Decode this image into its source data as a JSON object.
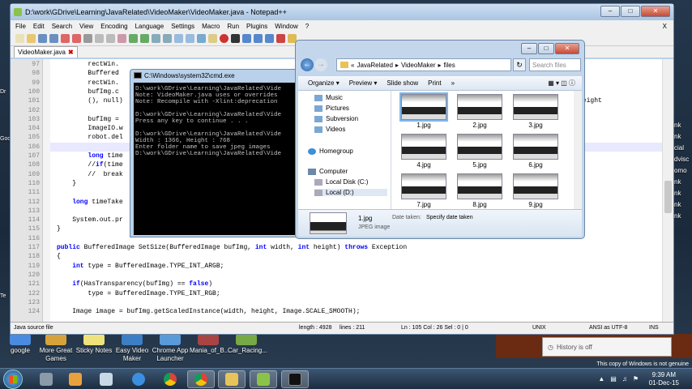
{
  "notepad": {
    "title": "D:\\work\\GDrive\\Learning\\JavaRelated\\VideoMaker\\VideoMaker.java - Notepad++",
    "menu": [
      "File",
      "Edit",
      "Search",
      "View",
      "Encoding",
      "Language",
      "Settings",
      "Macro",
      "Run",
      "Plugins",
      "Window",
      "?"
    ],
    "close_x": "X",
    "tab": "VideoMaker.java",
    "lines": [
      {
        "n": "97",
        "code": "        rectWin."
      },
      {
        "n": "98",
        "code": "        Buffered"
      },
      {
        "n": "99",
        "code": "        rectWin."
      },
      {
        "n": "100",
        "code": "        bufImg.c"
      },
      {
        "n": "101",
        "code": "        (), null)"
      },
      {
        "n": "102",
        "code": ""
      },
      {
        "n": "103",
        "code": "        bufImg ="
      },
      {
        "n": "104",
        "code": "        ImageIO.w"
      },
      {
        "n": "105",
        "code": "        robot.del"
      },
      {
        "n": "106",
        "code": ""
      },
      {
        "n": "107",
        "code": "        long time"
      },
      {
        "n": "108",
        "code": "        //if(time"
      },
      {
        "n": "109",
        "code": "        //  break"
      },
      {
        "n": "110",
        "code": "    }"
      },
      {
        "n": "111",
        "code": ""
      },
      {
        "n": "112",
        "code": "    long timeTake"
      },
      {
        "n": "113",
        "code": ""
      },
      {
        "n": "114",
        "code": "    System.out.pr"
      },
      {
        "n": "115",
        "code": "}"
      },
      {
        "n": "116",
        "code": ""
      },
      {
        "n": "117",
        "code": "public BufferedImage SetSize(BufferedImage bufImg, int width, int height) throws Exception"
      },
      {
        "n": "118",
        "code": "{"
      },
      {
        "n": "119",
        "code": "    int type = BufferedImage.TYPE_INT_ARGB;"
      },
      {
        "n": "120",
        "code": ""
      },
      {
        "n": "121",
        "code": "    if(HasTransparency(bufImg) == false)"
      },
      {
        "n": "122",
        "code": "        type = BufferedImage.TYPE_INT_RGB;"
      },
      {
        "n": "123",
        "code": ""
      },
      {
        "n": "124",
        "code": "    Image image = bufImg.getScaledInstance(width, height, Image.SCALE_SMOOTH);"
      }
    ],
    "right_fragment": "cursor.getHeight",
    "status": {
      "type": "Java source file",
      "length": "length : 4928",
      "lines": "lines : 211",
      "pos": "Ln : 105    Col : 26    Sel : 0 | 0",
      "eol": "UNIX",
      "enc": "ANSI as UTF-8",
      "ins": "INS"
    }
  },
  "cmd": {
    "title": "C:\\Windows\\system32\\cmd.exe",
    "output": "D:\\work\\GDrive\\Learning\\JavaRelated\\Vide\nNote: VideoMaker.java uses or overrides\nNote: Recompile with -Xlint:deprecation\n\nD:\\work\\GDrive\\Learning\\JavaRelated\\Vide\nPress any key to continue . . .\n\nD:\\work\\GDrive\\Learning\\JavaRelated\\Vide\nWidth : 1366, Height : 768\nEnter folder name to save jpeg images\nD:\\work\\GDrive\\Learning\\JavaRelated\\Vide"
  },
  "explorer": {
    "breadcrumb": [
      "«",
      "JavaRelated",
      "VideoMaker",
      "files"
    ],
    "search_placeholder": "Search files",
    "commands": [
      "Organize",
      "Preview",
      "Slide show",
      "Print",
      "»"
    ],
    "nav": [
      "Music",
      "Pictures",
      "Subversion",
      "Videos",
      "Homegroup",
      "Computer",
      "Local Disk (C:)",
      "Local (D:)"
    ],
    "files": [
      "1.jpg",
      "2.jpg",
      "3.jpg",
      "4.jpg",
      "5.jpg",
      "6.jpg",
      "7.jpg",
      "8.jpg",
      "9.jpg"
    ],
    "details": {
      "name": "1.jpg",
      "type": "JPEG image",
      "date_label": "Date taken:",
      "date_value": "Specify date taken"
    }
  },
  "desktop_icons": [
    "google",
    "More Great Games",
    "Sticky Notes",
    "Easy Video Maker",
    "Chrome App Launcher",
    "Mania_of_B...",
    "Car_Racing..."
  ],
  "desktop_right": [
    "nk",
    "nk",
    "cial",
    "dvisc",
    "omo",
    "nk",
    "nk",
    "nk",
    "nk"
  ],
  "desktop_left": [
    "Dr",
    "Goo",
    "Te"
  ],
  "history": "History is off",
  "not_genuine": "This copy of Windows is not genuine",
  "clock": {
    "time": "9:39 AM",
    "date": "01-Dec-15"
  },
  "colors": {
    "taskbar": "#1c2d40",
    "titlebar": "#b9d1ea",
    "keyword": "#0000ff",
    "cmd_bg": "#000000"
  }
}
